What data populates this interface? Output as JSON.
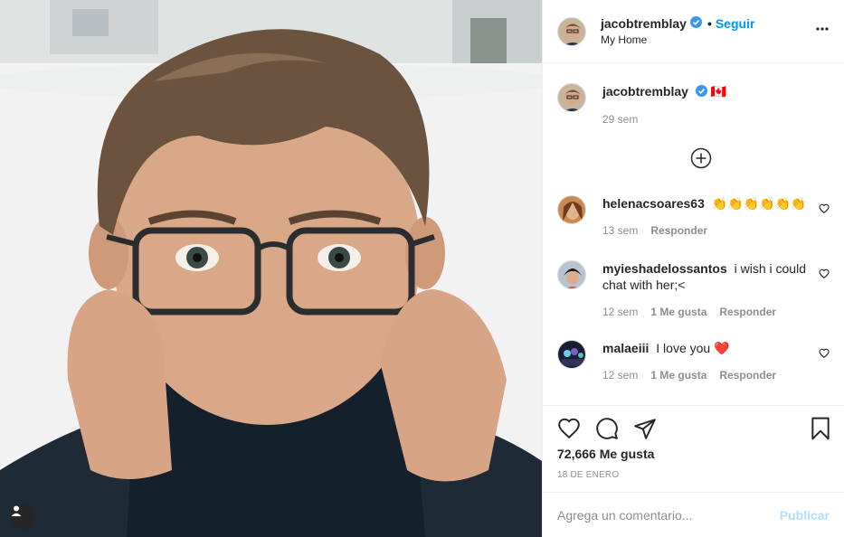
{
  "post": {
    "author": "jacobtremblay",
    "follow_label": "Seguir",
    "separator": "•",
    "location": "My Home",
    "caption_flag": "🇨🇦",
    "caption_time": "29 sem"
  },
  "comments": [
    {
      "user": "helenacsoares63",
      "text": "👏👏👏👏👏👏",
      "time": "13 sem",
      "likes": "",
      "reply": "Responder"
    },
    {
      "user": "myieshadelossantos",
      "text": "i wish i could chat with her;<",
      "time": "12 sem",
      "likes": "1 Me gusta",
      "reply": "Responder"
    },
    {
      "user": "malaeiii",
      "text": "I love you ❤️",
      "time": "12 sem",
      "likes": "1 Me gusta",
      "reply": "Responder"
    }
  ],
  "stats": {
    "likes": "72,666 Me gusta",
    "date": "18 DE ENERO"
  },
  "add_comment": {
    "placeholder": "Agrega un comentario...",
    "publish": "Publicar"
  },
  "icons": [
    "heart-icon",
    "comment-icon",
    "share-icon",
    "bookmark-icon",
    "more-icon",
    "plus-circle-icon",
    "verified-icon",
    "user-tag-icon"
  ],
  "colors": {
    "accent": "#0095f6",
    "publish_disabled": "#b2dffc",
    "muted": "#8e8e8e",
    "verified": "#3897f0"
  }
}
